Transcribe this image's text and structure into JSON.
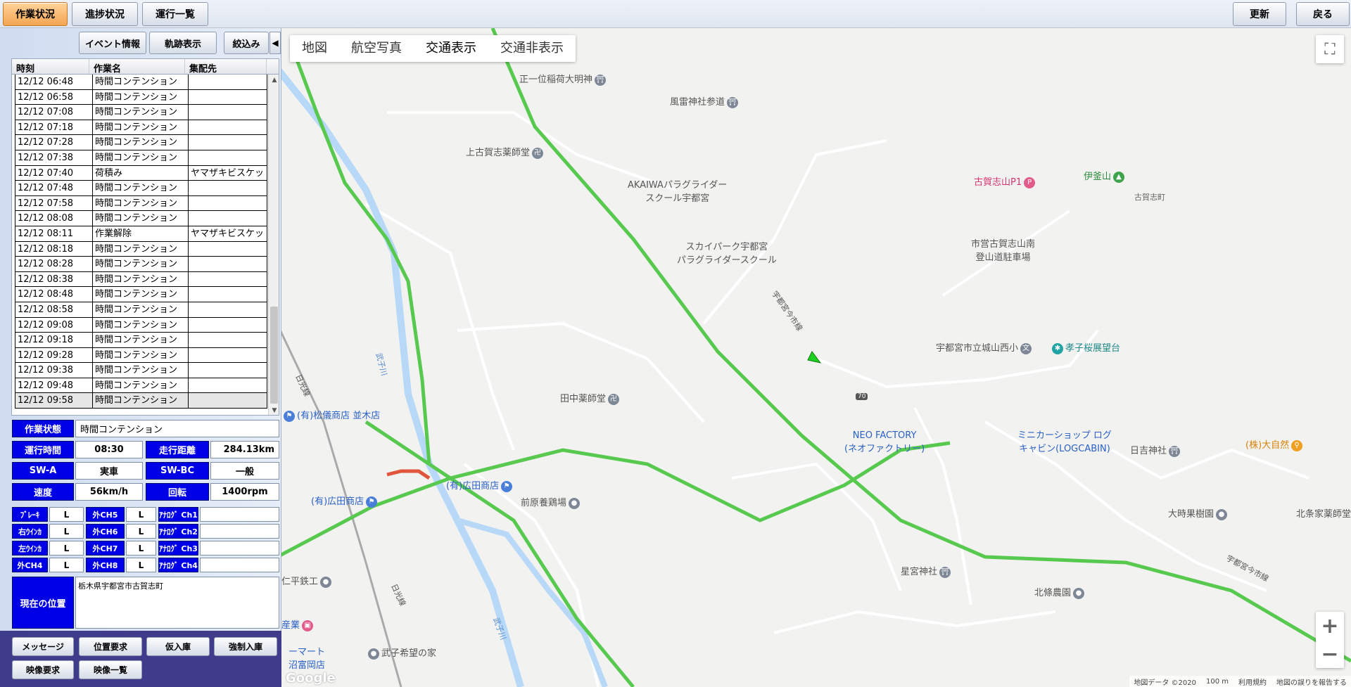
{
  "topbar": {
    "tab_work_status": "作業状況",
    "tab_progress": "進捗状況",
    "tab_operation_list": "運行一覧",
    "refresh": "更新",
    "back": "戻る"
  },
  "subbar": {
    "event_info": "イベント情報",
    "track_display": "軌跡表示",
    "filter": "絞込み",
    "collapse": "◀"
  },
  "table": {
    "headers": [
      "時刻",
      "作業名",
      "集配先"
    ],
    "rows": [
      [
        "12/12 06:48",
        "時間コンテンション",
        ""
      ],
      [
        "12/12 06:58",
        "時間コンテンション",
        ""
      ],
      [
        "12/12 07:08",
        "時間コンテンション",
        ""
      ],
      [
        "12/12 07:18",
        "時間コンテンション",
        ""
      ],
      [
        "12/12 07:28",
        "時間コンテンション",
        ""
      ],
      [
        "12/12 07:38",
        "時間コンテンション",
        ""
      ],
      [
        "12/12 07:40",
        "荷積み",
        "ヤマザキビスケット㈱"
      ],
      [
        "12/12 07:48",
        "時間コンテンション",
        ""
      ],
      [
        "12/12 07:58",
        "時間コンテンション",
        ""
      ],
      [
        "12/12 08:08",
        "時間コンテンション",
        ""
      ],
      [
        "12/12 08:11",
        "作業解除",
        "ヤマザキビスケット㈱"
      ],
      [
        "12/12 08:18",
        "時間コンテンション",
        ""
      ],
      [
        "12/12 08:28",
        "時間コンテンション",
        ""
      ],
      [
        "12/12 08:38",
        "時間コンテンション",
        ""
      ],
      [
        "12/12 08:48",
        "時間コンテンション",
        ""
      ],
      [
        "12/12 08:58",
        "時間コンテンション",
        ""
      ],
      [
        "12/12 09:08",
        "時間コンテンション",
        ""
      ],
      [
        "12/12 09:18",
        "時間コンテンション",
        ""
      ],
      [
        "12/12 09:28",
        "時間コンテンション",
        ""
      ],
      [
        "12/12 09:38",
        "時間コンテンション",
        ""
      ],
      [
        "12/12 09:48",
        "時間コンテンション",
        ""
      ],
      [
        "12/12 09:58",
        "時間コンテンション",
        ""
      ]
    ]
  },
  "status": {
    "work_state_label": "作業状態",
    "work_state_value": "時間コンテンション",
    "run_time_label": "運行時間",
    "run_time_value": "08:30",
    "distance_label": "走行距離",
    "distance_value": "284.13km",
    "swa_label": "SW-A",
    "swa_value": "実車",
    "swbc_label": "SW-BC",
    "swbc_value": "一般",
    "speed_label": "速度",
    "speed_value": "56km/h",
    "rpm_label": "回転",
    "rpm_value": "1400rpm"
  },
  "signals": [
    [
      {
        "label": "ﾌﾞﾚｰｷ",
        "value": "L"
      },
      {
        "label": "外CH5",
        "value": "L"
      },
      {
        "label": "ｱﾅﾛｸﾞ Ch1",
        "value": ""
      }
    ],
    [
      {
        "label": "右ｳｲﾝｶ",
        "value": "L"
      },
      {
        "label": "外CH6",
        "value": "L"
      },
      {
        "label": "ｱﾅﾛｸﾞ Ch2",
        "value": ""
      }
    ],
    [
      {
        "label": "左ｳｲﾝｶ",
        "value": "L"
      },
      {
        "label": "外CH7",
        "value": "L"
      },
      {
        "label": "ｱﾅﾛｸﾞ Ch3",
        "value": ""
      }
    ],
    [
      {
        "label": "外CH4",
        "value": "L"
      },
      {
        "label": "外CH8",
        "value": "L"
      },
      {
        "label": "ｱﾅﾛｸﾞ Ch4",
        "value": ""
      }
    ]
  ],
  "location": {
    "label": "現在の位置",
    "value": "栃木県宇都宮市古賀志町"
  },
  "bottom": {
    "message": "メッセージ",
    "position_request": "位置要求",
    "temp_entry": "仮入庫",
    "force_entry": "強制入庫",
    "video_request": "映像要求",
    "video_list": "映像一覧"
  },
  "map": {
    "types": [
      "地図",
      "航空写真",
      "交通表示",
      "交通非表示"
    ],
    "pois": {
      "p1": "正一位稲荷大明神",
      "p2": "風雷神社参道",
      "p3": "上古賀志薬師堂",
      "p4a": "AKAIWAパラグライダー",
      "p4b": "スクール宇都宮",
      "p5a": "スカイパーク宇都宮",
      "p5b": "パラグライダースクール",
      "p6": "古賀志山P1",
      "p7": "伊釜山",
      "p8": "古賀志町",
      "p9a": "市営古賀志山南",
      "p9b": "登山道駐車場",
      "p10": "宇都宮市立城山西小",
      "p11": "孝子桜展望台",
      "p12": "田中薬師堂",
      "p13": "(有)松儀商店 並木店",
      "p14a": "NEO FACTORY",
      "p14b": "(ネオファクトリー)",
      "p15a": "ミニカーショップ ログ",
      "p15b": "キャビン(LOGCABIN)",
      "p16": "日吉神社",
      "p17": "(株)大自然",
      "p18": "(有)広田商店",
      "p19": "(有)広田商店",
      "p20": "前原養鶏場",
      "p21": "大時果樹園",
      "p22": "北条家薬師堂",
      "p23": "仁平鉄工",
      "p24": "星宮神社",
      "p25": "北條農園",
      "p26": "武子希望の家",
      "p27": "産業",
      "p28a": "ーマート",
      "p28b": "沼富岡店",
      "road1": "宇都宮今市線",
      "road2": "宇都宮今市線",
      "rail1": "日光線",
      "rail2": "日光線",
      "river1": "武子川",
      "river2": "武子川",
      "route": "70"
    },
    "attribution": [
      "地図データ ©2020",
      "100 m",
      "利用規約",
      "地図の誤りを報告する"
    ],
    "logo": "Google"
  }
}
